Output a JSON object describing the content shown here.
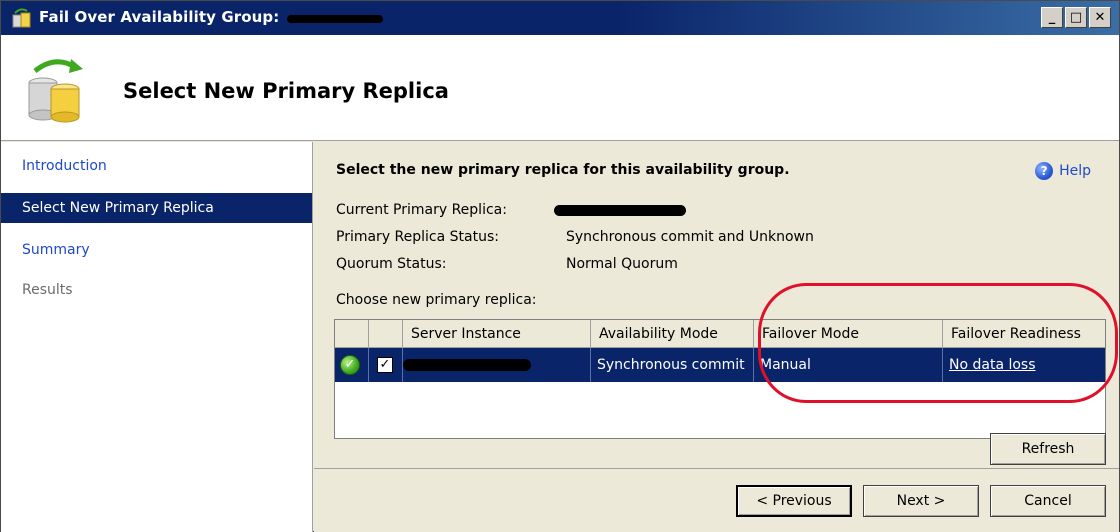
{
  "window": {
    "title": "Fail Over Availability Group:",
    "controls": {
      "minimize": "_",
      "maximize": "□",
      "close": "✕"
    }
  },
  "header": {
    "title": "Select New Primary Replica"
  },
  "sidebar": {
    "items": [
      {
        "label": "Introduction",
        "state": "link"
      },
      {
        "label": "Select New Primary Replica",
        "state": "active"
      },
      {
        "label": "Summary",
        "state": "link"
      },
      {
        "label": "Results",
        "state": "disabled"
      }
    ]
  },
  "main": {
    "heading": "Select the new primary replica for this availability group.",
    "help_label": "Help",
    "info": [
      {
        "label": "Current Primary Replica:",
        "value": ""
      },
      {
        "label": "Primary Replica Status:",
        "value": "Synchronous commit and Unknown"
      },
      {
        "label": "Quorum Status:",
        "value": "Normal Quorum"
      }
    ],
    "choose_label": "Choose new primary replica:",
    "grid": {
      "columns": [
        "",
        "",
        "Server Instance",
        "Availability Mode",
        "Failover Mode",
        "Failover Readiness"
      ],
      "rows": [
        {
          "status_icon": "check-circle-icon",
          "selected": true,
          "server_instance": "",
          "availability_mode": "Synchronous commit",
          "failover_mode": "Manual",
          "failover_readiness": "No data loss"
        }
      ]
    },
    "refresh_label": "Refresh"
  },
  "footer": {
    "previous_label": "< Previous",
    "next_label": "Next >",
    "cancel_label": "Cancel"
  },
  "colors": {
    "titlebar": "#0a246a",
    "selection": "#0a246a",
    "link": "#1f49c8",
    "annotation": "#e0102a",
    "dialog_bg": "#ece9d8"
  }
}
